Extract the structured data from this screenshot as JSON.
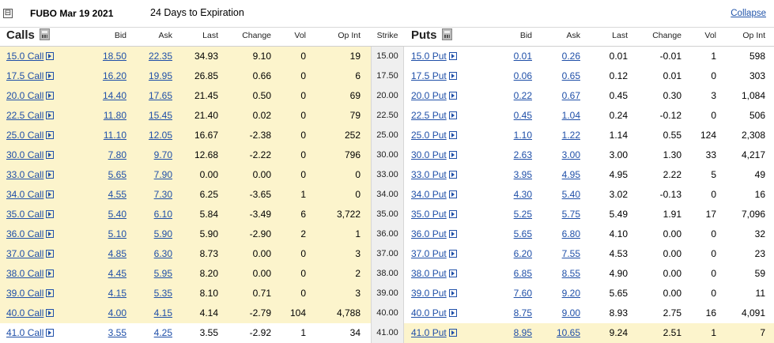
{
  "header": {
    "title": "FUBO Mar 19 2021",
    "expiry": "24 Days to Expiration",
    "collapse_label": "Collapse",
    "toggle_glyph": "⊟"
  },
  "columns": {
    "calls_title": "Calls",
    "puts_title": "Puts",
    "bid": "Bid",
    "ask": "Ask",
    "last": "Last",
    "change": "Change",
    "vol": "Vol",
    "open_int": "Op Int",
    "strike": "Strike"
  },
  "rows": [
    {
      "call": "15.0 Call",
      "c_bid": "18.50",
      "c_ask": "22.35",
      "c_last": "34.93",
      "c_chg": "9.10",
      "c_vol": "0",
      "c_oi": "19",
      "strike": "15.00",
      "put": "15.0 Put",
      "p_bid": "0.01",
      "p_ask": "0.26",
      "p_last": "0.01",
      "p_chg": "-0.01",
      "p_vol": "1",
      "p_oi": "598"
    },
    {
      "call": "17.5 Call",
      "c_bid": "16.20",
      "c_ask": "19.95",
      "c_last": "26.85",
      "c_chg": "0.66",
      "c_vol": "0",
      "c_oi": "6",
      "strike": "17.50",
      "put": "17.5 Put",
      "p_bid": "0.06",
      "p_ask": "0.65",
      "p_last": "0.12",
      "p_chg": "0.01",
      "p_vol": "0",
      "p_oi": "303"
    },
    {
      "call": "20.0 Call",
      "c_bid": "14.40",
      "c_ask": "17.65",
      "c_last": "21.45",
      "c_chg": "0.50",
      "c_vol": "0",
      "c_oi": "69",
      "strike": "20.00",
      "put": "20.0 Put",
      "p_bid": "0.22",
      "p_ask": "0.67",
      "p_last": "0.45",
      "p_chg": "0.30",
      "p_vol": "3",
      "p_oi": "1,084"
    },
    {
      "call": "22.5 Call",
      "c_bid": "11.80",
      "c_ask": "15.45",
      "c_last": "21.40",
      "c_chg": "0.02",
      "c_vol": "0",
      "c_oi": "79",
      "strike": "22.50",
      "put": "22.5 Put",
      "p_bid": "0.45",
      "p_ask": "1.04",
      "p_last": "0.24",
      "p_chg": "-0.12",
      "p_vol": "0",
      "p_oi": "506"
    },
    {
      "call": "25.0 Call",
      "c_bid": "11.10",
      "c_ask": "12.05",
      "c_last": "16.67",
      "c_chg": "-2.38",
      "c_vol": "0",
      "c_oi": "252",
      "strike": "25.00",
      "put": "25.0 Put",
      "p_bid": "1.10",
      "p_ask": "1.22",
      "p_last": "1.14",
      "p_chg": "0.55",
      "p_vol": "124",
      "p_oi": "2,308"
    },
    {
      "call": "30.0 Call",
      "c_bid": "7.80",
      "c_ask": "9.70",
      "c_last": "12.68",
      "c_chg": "-2.22",
      "c_vol": "0",
      "c_oi": "796",
      "strike": "30.00",
      "put": "30.0 Put",
      "p_bid": "2.63",
      "p_ask": "3.00",
      "p_last": "3.00",
      "p_chg": "1.30",
      "p_vol": "33",
      "p_oi": "4,217"
    },
    {
      "call": "33.0 Call",
      "c_bid": "5.65",
      "c_ask": "7.90",
      "c_last": "0.00",
      "c_chg": "0.00",
      "c_vol": "0",
      "c_oi": "0",
      "strike": "33.00",
      "put": "33.0 Put",
      "p_bid": "3.95",
      "p_ask": "4.95",
      "p_last": "4.95",
      "p_chg": "2.22",
      "p_vol": "5",
      "p_oi": "49"
    },
    {
      "call": "34.0 Call",
      "c_bid": "4.55",
      "c_ask": "7.30",
      "c_last": "6.25",
      "c_chg": "-3.65",
      "c_vol": "1",
      "c_oi": "0",
      "strike": "34.00",
      "put": "34.0 Put",
      "p_bid": "4.30",
      "p_ask": "5.40",
      "p_last": "3.02",
      "p_chg": "-0.13",
      "p_vol": "0",
      "p_oi": "16"
    },
    {
      "call": "35.0 Call",
      "c_bid": "5.40",
      "c_ask": "6.10",
      "c_last": "5.84",
      "c_chg": "-3.49",
      "c_vol": "6",
      "c_oi": "3,722",
      "strike": "35.00",
      "put": "35.0 Put",
      "p_bid": "5.25",
      "p_ask": "5.75",
      "p_last": "5.49",
      "p_chg": "1.91",
      "p_vol": "17",
      "p_oi": "7,096"
    },
    {
      "call": "36.0 Call",
      "c_bid": "5.10",
      "c_ask": "5.90",
      "c_last": "5.90",
      "c_chg": "-2.90",
      "c_vol": "2",
      "c_oi": "1",
      "strike": "36.00",
      "put": "36.0 Put",
      "p_bid": "5.65",
      "p_ask": "6.80",
      "p_last": "4.10",
      "p_chg": "0.00",
      "p_vol": "0",
      "p_oi": "32"
    },
    {
      "call": "37.0 Call",
      "c_bid": "4.85",
      "c_ask": "6.30",
      "c_last": "8.73",
      "c_chg": "0.00",
      "c_vol": "0",
      "c_oi": "3",
      "strike": "37.00",
      "put": "37.0 Put",
      "p_bid": "6.20",
      "p_ask": "7.55",
      "p_last": "4.53",
      "p_chg": "0.00",
      "p_vol": "0",
      "p_oi": "23"
    },
    {
      "call": "38.0 Call",
      "c_bid": "4.45",
      "c_ask": "5.95",
      "c_last": "8.20",
      "c_chg": "0.00",
      "c_vol": "0",
      "c_oi": "2",
      "strike": "38.00",
      "put": "38.0 Put",
      "p_bid": "6.85",
      "p_ask": "8.55",
      "p_last": "4.90",
      "p_chg": "0.00",
      "p_vol": "0",
      "p_oi": "59"
    },
    {
      "call": "39.0 Call",
      "c_bid": "4.15",
      "c_ask": "5.35",
      "c_last": "8.10",
      "c_chg": "0.71",
      "c_vol": "0",
      "c_oi": "3",
      "strike": "39.00",
      "put": "39.0 Put",
      "p_bid": "7.60",
      "p_ask": "9.20",
      "p_last": "5.65",
      "p_chg": "0.00",
      "p_vol": "0",
      "p_oi": "11"
    },
    {
      "call": "40.0 Call",
      "c_bid": "4.00",
      "c_ask": "4.15",
      "c_last": "4.14",
      "c_chg": "-2.79",
      "c_vol": "104",
      "c_oi": "4,788",
      "strike": "40.00",
      "put": "40.0 Put",
      "p_bid": "8.75",
      "p_ask": "9.00",
      "p_last": "8.93",
      "p_chg": "2.75",
      "p_vol": "16",
      "p_oi": "4,091"
    },
    {
      "call": "41.0 Call",
      "c_bid": "3.55",
      "c_ask": "4.25",
      "c_last": "3.55",
      "c_chg": "-2.92",
      "c_vol": "1",
      "c_oi": "34",
      "strike": "41.00",
      "put": "41.0 Put",
      "p_bid": "8.95",
      "p_ask": "10.65",
      "p_last": "9.24",
      "p_chg": "2.51",
      "p_vol": "1",
      "p_oi": "7"
    }
  ]
}
